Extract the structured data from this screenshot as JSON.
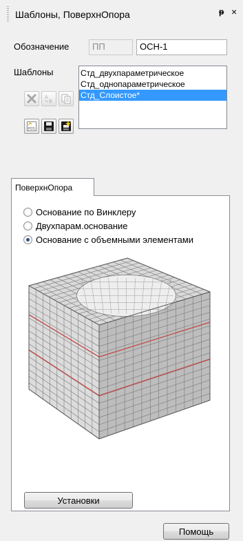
{
  "window": {
    "title": "Шаблоны, ПоверхнОпора",
    "pin_glyph": "ᵽ",
    "close_glyph": "×"
  },
  "designation": {
    "label": "Обозначение",
    "prefix_value": "ПП",
    "value": "ОСН-1"
  },
  "templates": {
    "label": "Шаблоны",
    "items": [
      {
        "label": "Стд_двухпараметрическое",
        "selected": false
      },
      {
        "label": "Стд_однопараметрическое",
        "selected": false
      },
      {
        "label": "Стд_Слоистое*",
        "selected": true
      }
    ],
    "toolbar": [
      {
        "name": "delete-icon",
        "enabled": false
      },
      {
        "name": "rename-icon",
        "enabled": false
      },
      {
        "name": "copy-icon",
        "enabled": false
      },
      {
        "name": "import-pos-icon",
        "enabled": true
      },
      {
        "name": "save-icon",
        "enabled": true
      },
      {
        "name": "save-new-icon",
        "enabled": true
      }
    ]
  },
  "tab": {
    "label": "ПоверхнОпора"
  },
  "foundation": {
    "options": [
      {
        "label": "Основание по Винклеру",
        "checked": false
      },
      {
        "label": "Двухпарам.основание",
        "checked": false
      },
      {
        "label": "Основание с объемными элементами",
        "checked": true
      }
    ]
  },
  "buttons": {
    "settings": "Установки",
    "help": "Помощь"
  },
  "colors": {
    "selection": "#3399ff",
    "layer_line": "#c0504d",
    "mesh_top": "#d9d9d9",
    "mesh_front": "#dcdcdc",
    "mesh_side": "#bdbdbd"
  }
}
